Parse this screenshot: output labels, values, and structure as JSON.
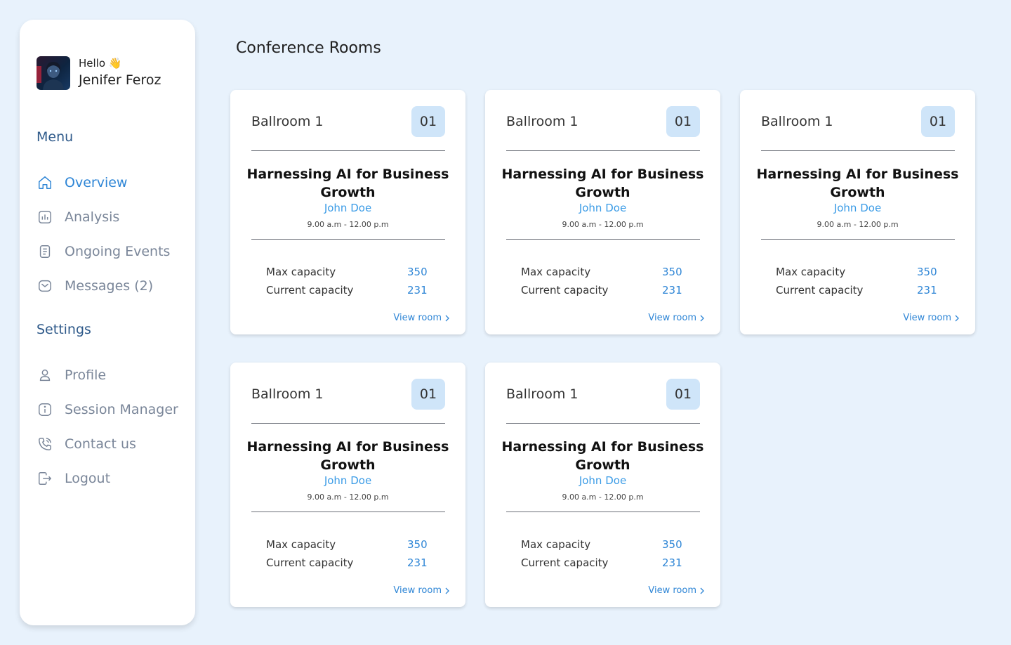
{
  "user": {
    "greeting": "Hello 👋",
    "name": "Jenifer Feroz"
  },
  "menu": {
    "title": "Menu",
    "items": [
      {
        "label": "Overview",
        "icon": "home-icon",
        "active": true
      },
      {
        "label": "Analysis",
        "icon": "chart-icon"
      },
      {
        "label": "Ongoing Events",
        "icon": "document-icon"
      },
      {
        "label": "Messages (2)",
        "icon": "mail-icon"
      }
    ]
  },
  "settings": {
    "title": "Settings",
    "items": [
      {
        "label": "Profile",
        "icon": "user-icon"
      },
      {
        "label": "Session Manager",
        "icon": "info-icon"
      },
      {
        "label": "Contact us",
        "icon": "phone-icon"
      },
      {
        "label": "Logout",
        "icon": "logout-icon"
      }
    ]
  },
  "page": {
    "title": "Conference Rooms"
  },
  "cards": [
    {
      "room": "Ballroom 1",
      "number": "01",
      "event": "Harnessing AI for Business Growth",
      "host": "John Doe",
      "time": "9.00 a.m - 12.00 p.m",
      "max_label": "Max capacity",
      "max_value": "350",
      "current_label": "Current capacity",
      "current_value": "231",
      "link": "View room"
    },
    {
      "room": "Ballroom 1",
      "number": "01",
      "event": "Harnessing AI for Business Growth",
      "host": "John Doe",
      "time": "9.00 a.m - 12.00 p.m",
      "max_label": "Max capacity",
      "max_value": "350",
      "current_label": "Current capacity",
      "current_value": "231",
      "link": "View room"
    },
    {
      "room": "Ballroom 1",
      "number": "01",
      "event": "Harnessing AI for Business Growth",
      "host": "John Doe",
      "time": "9.00 a.m - 12.00 p.m",
      "max_label": "Max capacity",
      "max_value": "350",
      "current_label": "Current capacity",
      "current_value": "231",
      "link": "View room"
    },
    {
      "room": "Ballroom 1",
      "number": "01",
      "event": "Harnessing AI for Business Growth",
      "host": "John Doe",
      "time": "9.00 a.m - 12.00 p.m",
      "max_label": "Max capacity",
      "max_value": "350",
      "current_label": "Current capacity",
      "current_value": "231",
      "link": "View room"
    },
    {
      "room": "Ballroom 1",
      "number": "01",
      "event": "Harnessing AI for Business Growth",
      "host": "John Doe",
      "time": "9.00 a.m - 12.00 p.m",
      "max_label": "Max capacity",
      "max_value": "350",
      "current_label": "Current capacity",
      "current_value": "231",
      "link": "View room"
    }
  ],
  "colors": {
    "background": "#e8f2fc",
    "accent": "#2f86d6",
    "badge": "#cfe5f9",
    "host": "#3a9be6"
  }
}
